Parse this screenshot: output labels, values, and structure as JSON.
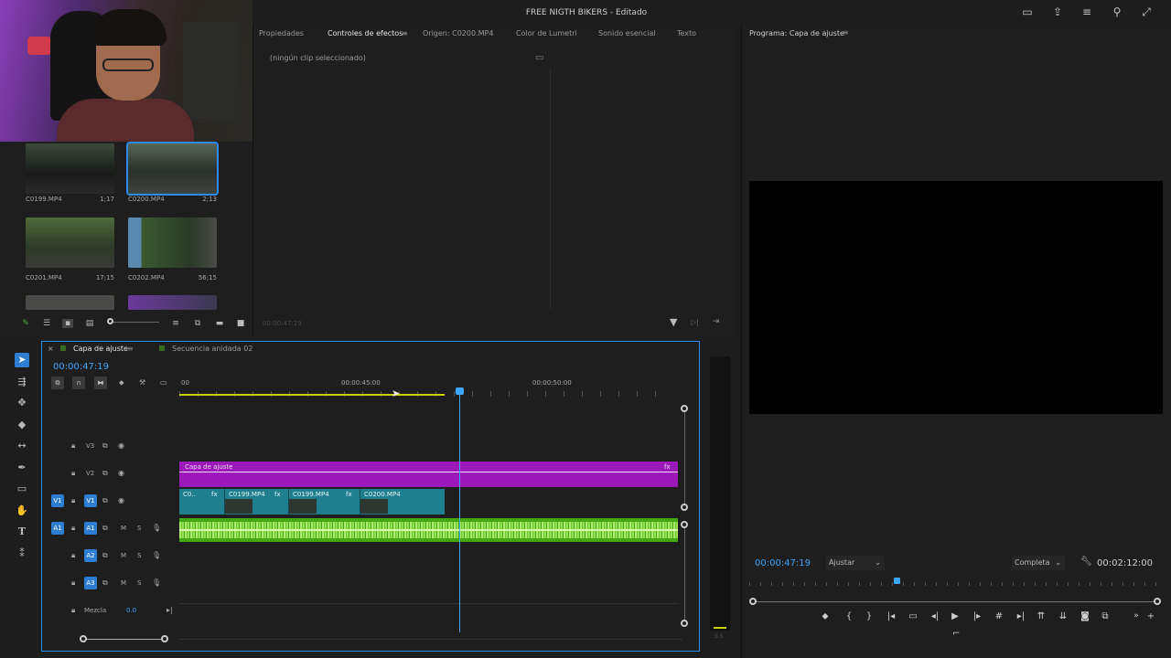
{
  "app": {
    "title": "FREE NIGTH BIKERS - Editado"
  },
  "effects_panel": {
    "tabs": [
      "Propiedades",
      "Controles de efectos",
      "Origen: C0200.MP4",
      "Color de Lumetri",
      "Sonido esencial",
      "Texto"
    ],
    "active_tab": "Controles de efectos",
    "no_clip": "(ningún clip seleccionado)",
    "timecode": "00:00:47:19"
  },
  "bin": {
    "clips": [
      {
        "name": "C0199.MP4",
        "duration": "1;17"
      },
      {
        "name": "C0200.MP4",
        "duration": "2;13",
        "selected": true
      },
      {
        "name": "C0201.MP4",
        "duration": "17;15"
      },
      {
        "name": "C0202.MP4",
        "duration": "56;15"
      }
    ]
  },
  "program": {
    "label": "Programa: Capa de ajuste",
    "timecode": "00:00:47:19",
    "fit": "Ajustar",
    "quality": "Completa",
    "duration": "00:02:12:00"
  },
  "timeline": {
    "tabs": [
      "Capa de ajuste",
      "Secuencia anidada 02"
    ],
    "timecode": "00:00:47:19",
    "ruler": [
      "00",
      "00:00:45:00",
      "00:00:50:00"
    ],
    "tracks": {
      "v3": "V3",
      "v2": "V2",
      "v1": "V1",
      "v1_src": "V1",
      "a1": "A1",
      "a1_src": "A1",
      "a2": "A2",
      "a3": "A3",
      "mix": "Mezcla",
      "mix_val": "0.0",
      "m": "M",
      "s": "S"
    },
    "clips": {
      "adjustment": "Capa de ajuste",
      "fx": "fx",
      "v1": [
        "C0..",
        "C0199.MP4",
        "C0199.MP4",
        "C0200.MP4"
      ]
    }
  },
  "meter": {
    "labels": "S S"
  },
  "colors": {
    "accent": "#2d8ceb",
    "adjustment": "#9b19b8",
    "video": "#1f7f8e",
    "audio": "#43a812"
  }
}
